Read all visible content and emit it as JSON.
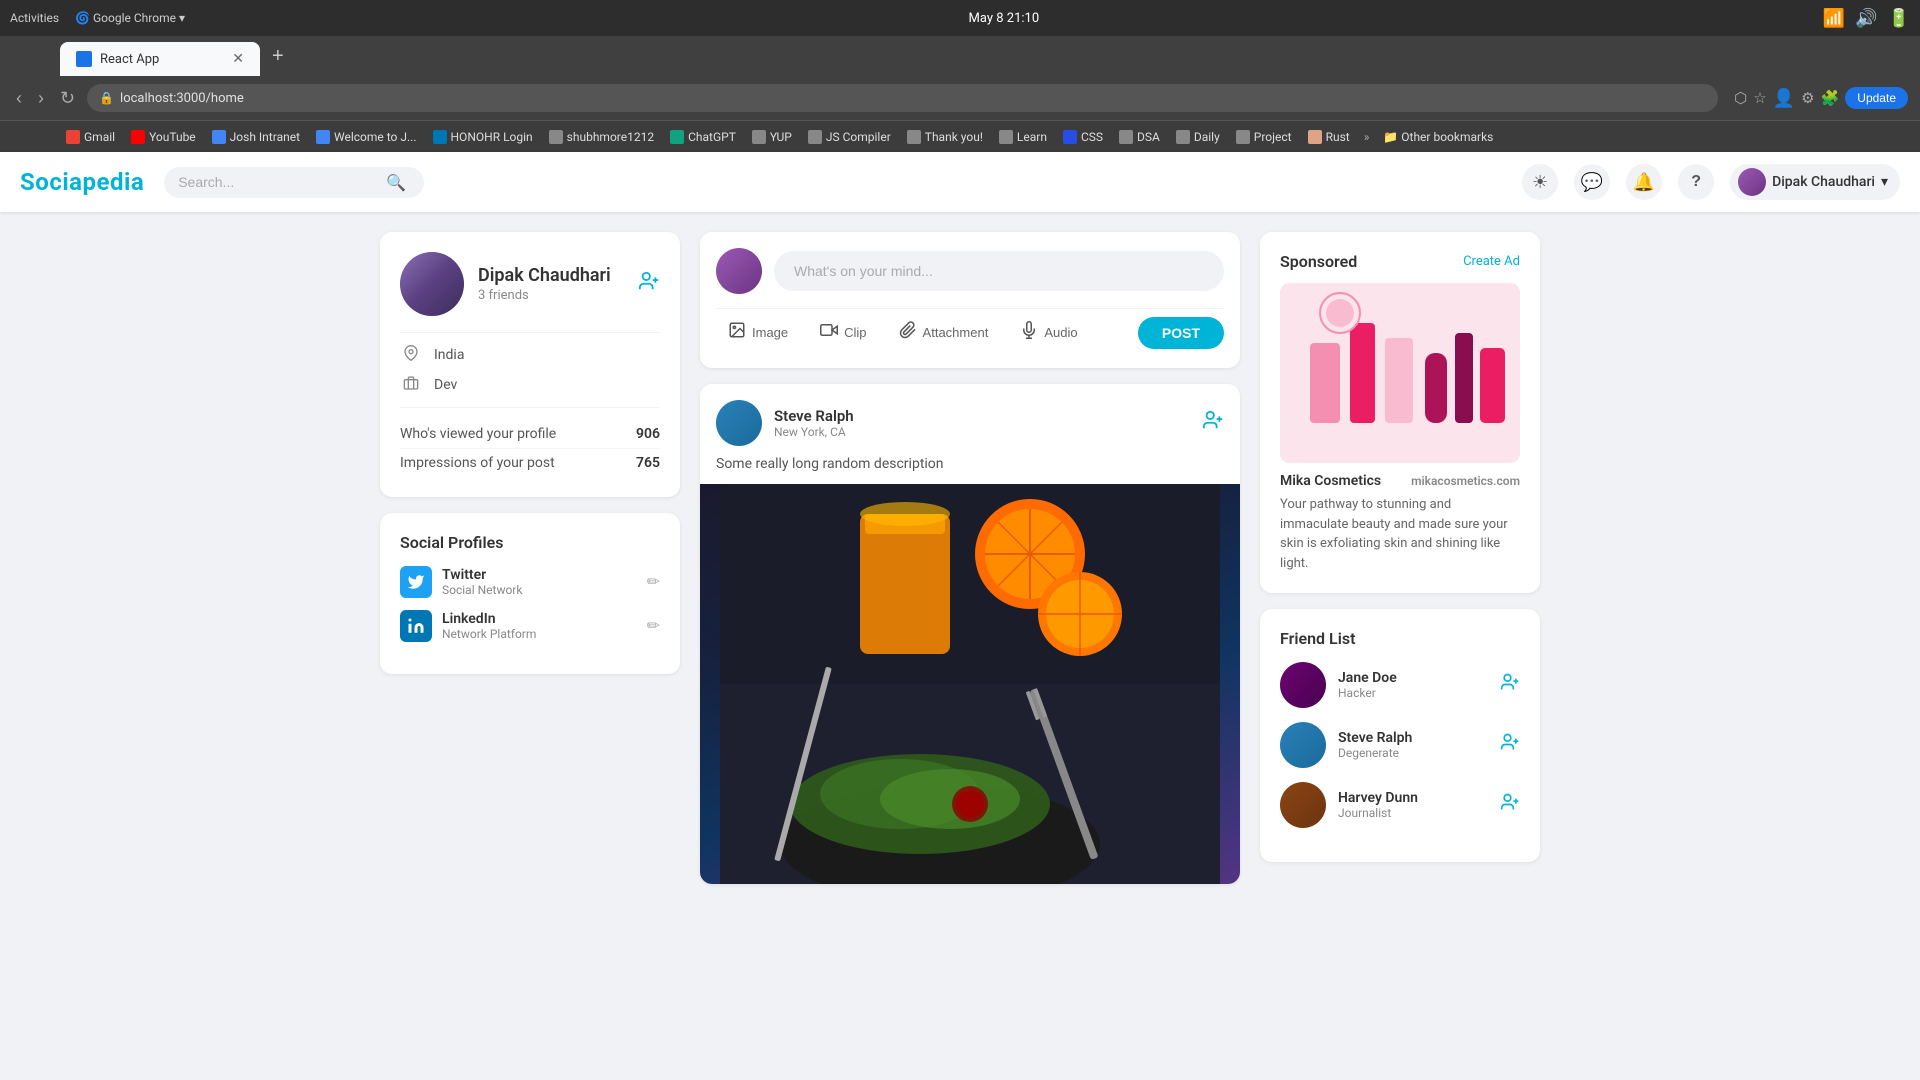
{
  "browser": {
    "tab_title": "React App",
    "url": "localhost:3000/home",
    "date_time": "May 8  21:10",
    "bookmarks": [
      {
        "label": "Gmail",
        "color": "#ea4335"
      },
      {
        "label": "YouTube",
        "color": "#ff0000"
      },
      {
        "label": "Josh Intranet",
        "color": "#4285f4"
      },
      {
        "label": "Welcome to J...",
        "color": "#4285f4"
      },
      {
        "label": "HONOHR Login",
        "color": "#0077b5"
      },
      {
        "label": "shubhmore1212",
        "color": "#888"
      },
      {
        "label": "ChatGPT",
        "color": "#10a37f"
      },
      {
        "label": "YUP",
        "color": "#888"
      },
      {
        "label": "JS Compiler",
        "color": "#888"
      },
      {
        "label": "Thank you!",
        "color": "#888"
      },
      {
        "label": "Learn",
        "color": "#888"
      },
      {
        "label": "CSS",
        "color": "#264de4"
      },
      {
        "label": "DSA",
        "color": "#888"
      },
      {
        "label": "Daily",
        "color": "#888"
      },
      {
        "label": "Project",
        "color": "#888"
      },
      {
        "label": "Rust",
        "color": "#dea584"
      },
      {
        "label": "Other bookmarks",
        "color": "#888"
      }
    ],
    "update_btn": "Update"
  },
  "app": {
    "logo": "Sociapedia",
    "search_placeholder": "Search..."
  },
  "navbar": {
    "theme_icon": "☀",
    "message_icon": "💬",
    "notification_icon": "🔔",
    "help_icon": "?",
    "user_name": "Dipak Chaudhari",
    "user_dropdown_arrow": "▾"
  },
  "left_sidebar": {
    "profile": {
      "name": "Dipak Chaudhari",
      "friends_count": "3 friends",
      "location": "India",
      "occupation": "Dev",
      "stats": [
        {
          "label": "Who's viewed your profile",
          "value": "906"
        },
        {
          "label": "Impressions of your post",
          "value": "765"
        }
      ]
    },
    "social_profiles": {
      "title": "Social Profiles",
      "items": [
        {
          "platform": "Twitter",
          "description": "Social Network"
        },
        {
          "platform": "LinkedIn",
          "description": "Network Platform"
        }
      ]
    }
  },
  "feed": {
    "composer": {
      "placeholder": "What's on your mind...",
      "actions": [
        {
          "icon": "🖼",
          "label": "Image"
        },
        {
          "icon": "🎬",
          "label": "Clip"
        },
        {
          "icon": "📎",
          "label": "Attachment"
        },
        {
          "icon": "🎤",
          "label": "Audio"
        }
      ],
      "post_btn": "POST"
    },
    "posts": [
      {
        "user_name": "Steve Ralph",
        "location": "New York, CA",
        "description": "Some really long random description"
      }
    ]
  },
  "right_sidebar": {
    "sponsored": {
      "title": "Sponsored",
      "create_ad": "Create Ad",
      "brand_name": "Mika Cosmetics",
      "brand_url": "mikacosmetics.com",
      "description": "Your pathway to stunning and immaculate beauty and made sure your skin is exfoliating skin and shining like light."
    },
    "friend_list": {
      "title": "Friend List",
      "friends": [
        {
          "name": "Jane Doe",
          "role": "Hacker"
        },
        {
          "name": "Steve Ralph",
          "role": "Degenerate"
        },
        {
          "name": "Harvey Dunn",
          "role": "Journalist"
        }
      ]
    }
  }
}
